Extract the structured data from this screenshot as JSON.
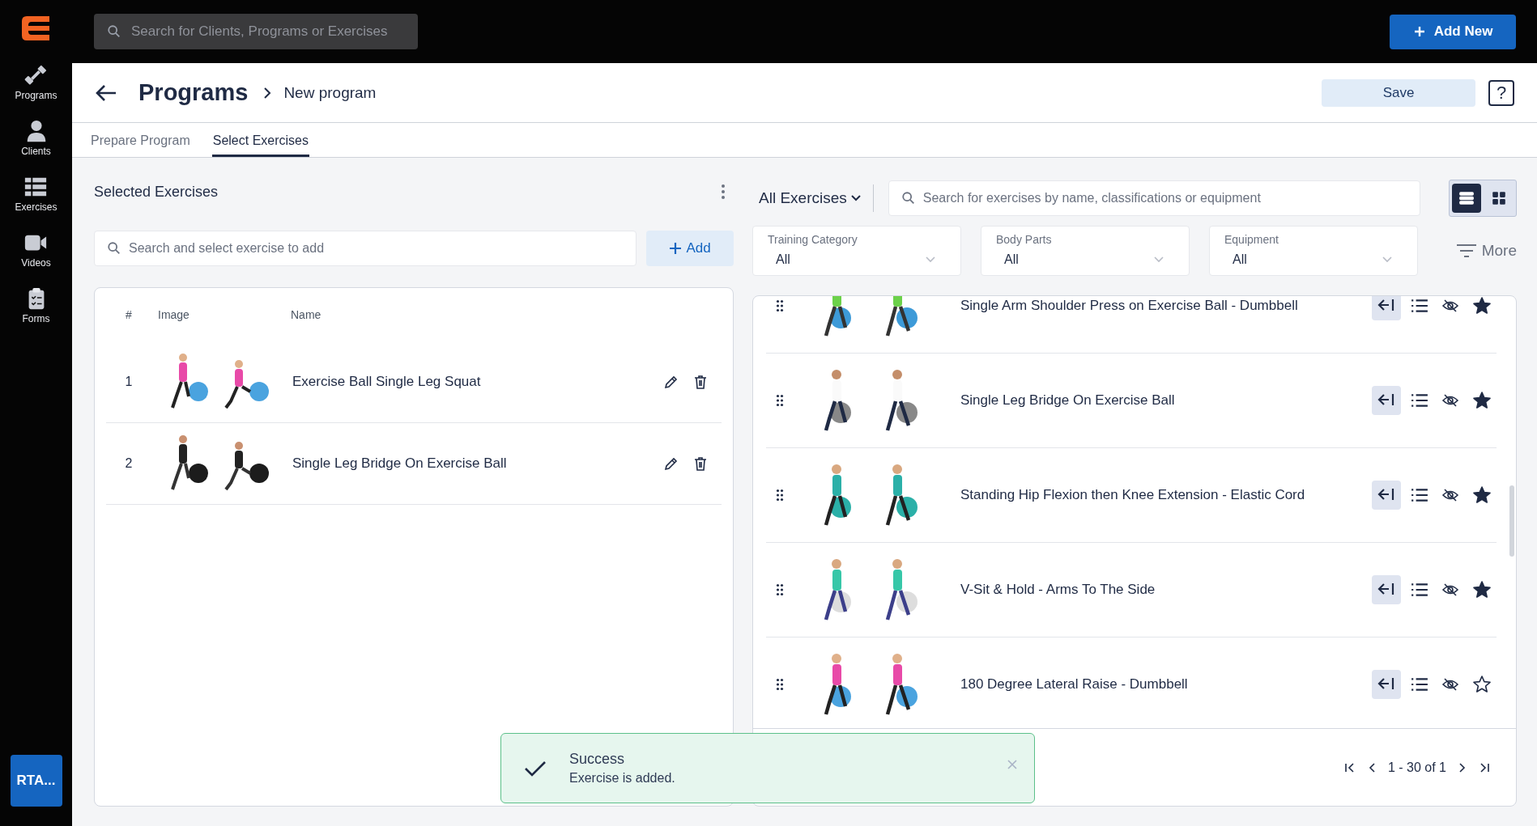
{
  "sidebar": {
    "items": [
      {
        "label": "Programs"
      },
      {
        "label": "Clients"
      },
      {
        "label": "Exercises"
      },
      {
        "label": "Videos"
      },
      {
        "label": "Forms"
      }
    ],
    "badge": "RTA..."
  },
  "top_bar": {
    "search_placeholder": "Search for Clients, Programs or Exercises",
    "add_button": "Add New"
  },
  "header": {
    "title": "Programs",
    "breadcrumb": "New program",
    "save_button": "Save",
    "help": "?"
  },
  "tabs": [
    {
      "label": "Prepare Program",
      "selected": false
    },
    {
      "label": "Select Exercises",
      "selected": true
    }
  ],
  "selected_exercises": {
    "title": "Selected Exercises",
    "search_placeholder": "Search and select exercise to add",
    "add_button": "Add",
    "columns": [
      "#",
      "Image",
      "Name"
    ],
    "rows": [
      {
        "number": "1",
        "name": "Exercise Ball Single Leg Squat"
      },
      {
        "number": "2",
        "name": "Single Leg Bridge On Exercise Ball"
      }
    ]
  },
  "library": {
    "filter": "All Exercises",
    "search_placeholder": "Search for exercises by name, classifications or equipment",
    "view_modes": [
      {
        "kind": "list",
        "selected": true
      },
      {
        "kind": "grid",
        "selected": false
      }
    ],
    "filters": [
      {
        "label": "Training Category",
        "value": "All"
      },
      {
        "label": "Body Parts",
        "value": "All"
      },
      {
        "label": "Equipment",
        "value": "All"
      }
    ],
    "more_button": "More",
    "exercises": [
      {
        "name": "Single Arm Shoulder Press on Exercise Ball - Dumbbell",
        "favorite": true
      },
      {
        "name": "Single Leg Bridge On Exercise Ball",
        "favorite": true
      },
      {
        "name": "Standing Hip Flexion then Knee Extension - Elastic Cord",
        "favorite": true
      },
      {
        "name": "V-Sit & Hold - Arms To The Side",
        "favorite": true
      },
      {
        "name": "180 Degree Lateral Raise - Dumbbell",
        "favorite": false
      }
    ],
    "pagination": {
      "range": "1 - 30 of 1"
    }
  },
  "toast": {
    "title": "Success",
    "message": "Exercise is added."
  }
}
